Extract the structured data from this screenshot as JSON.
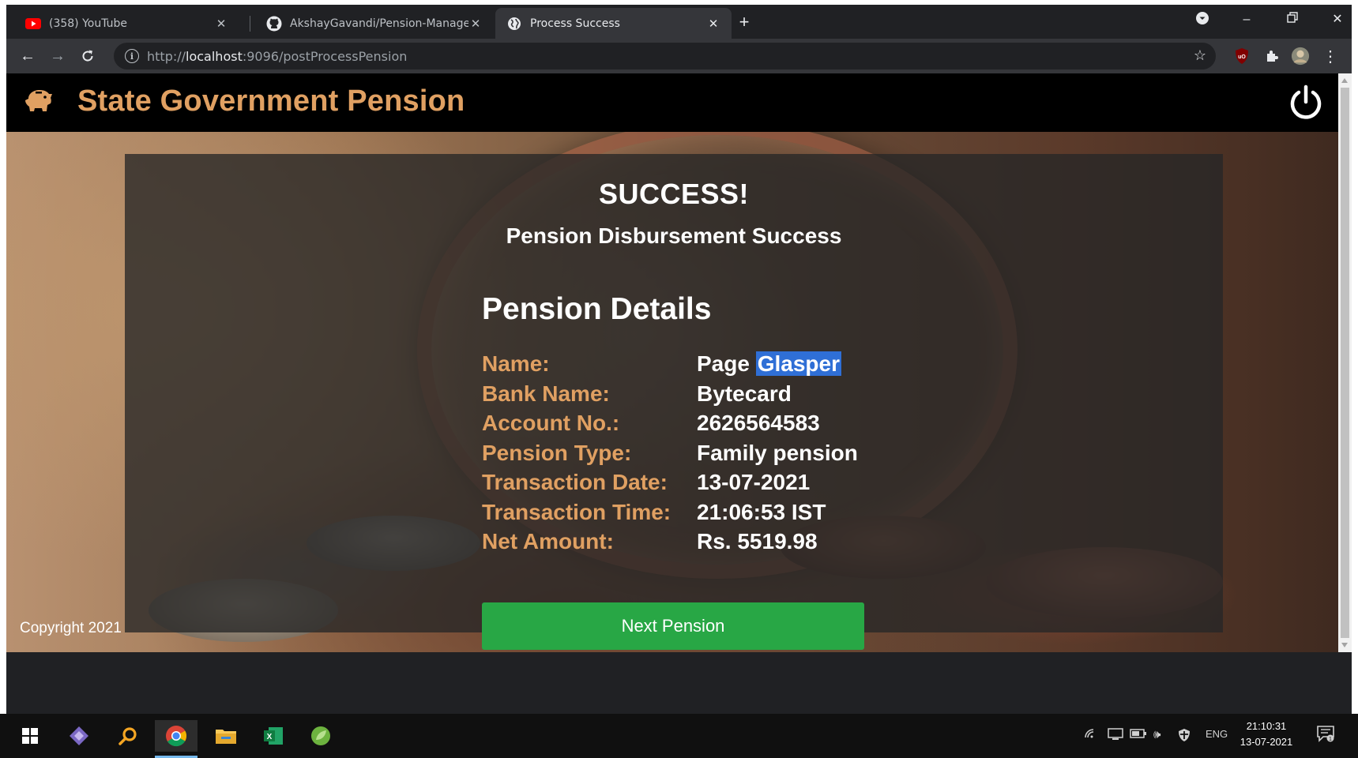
{
  "browser": {
    "tabs": [
      {
        "title": "(358) YouTube",
        "icon": "youtube-icon",
        "active": false
      },
      {
        "title": "AkshayGavandi/Pension-Manage",
        "icon": "github-icon",
        "active": false
      },
      {
        "title": "Process Success",
        "icon": "globe-icon",
        "active": true
      }
    ],
    "url_scheme": "http://",
    "url_host": "localhost",
    "url_rest": ":9096/postProcessPension"
  },
  "app": {
    "title": "State Government Pension",
    "brand_color": "#e0a062"
  },
  "card": {
    "success_title": "SUCCESS!",
    "success_subtitle": "Pension Disbursement Success",
    "details_heading": "Pension Details",
    "details": [
      {
        "label": "Name:",
        "value_pre": "Page ",
        "value_highlight": "Glasper"
      },
      {
        "label": "Bank Name:",
        "value": "Bytecard"
      },
      {
        "label": "Account No.:",
        "value": "2626564583"
      },
      {
        "label": "Pension Type:",
        "value": "Family pension"
      },
      {
        "label": "Transaction Date:",
        "value": "13-07-2021"
      },
      {
        "label": "Transaction Time:",
        "value": "21:06:53 IST"
      },
      {
        "label": "Net Amount:",
        "value": "Rs. 5519.98"
      }
    ],
    "next_button": "Next Pension",
    "button_color": "#28a745"
  },
  "footer": {
    "copyright": "Copyright 2021"
  },
  "taskbar": {
    "language": "ENG",
    "time": "21:10:31",
    "date": "13-07-2021"
  }
}
